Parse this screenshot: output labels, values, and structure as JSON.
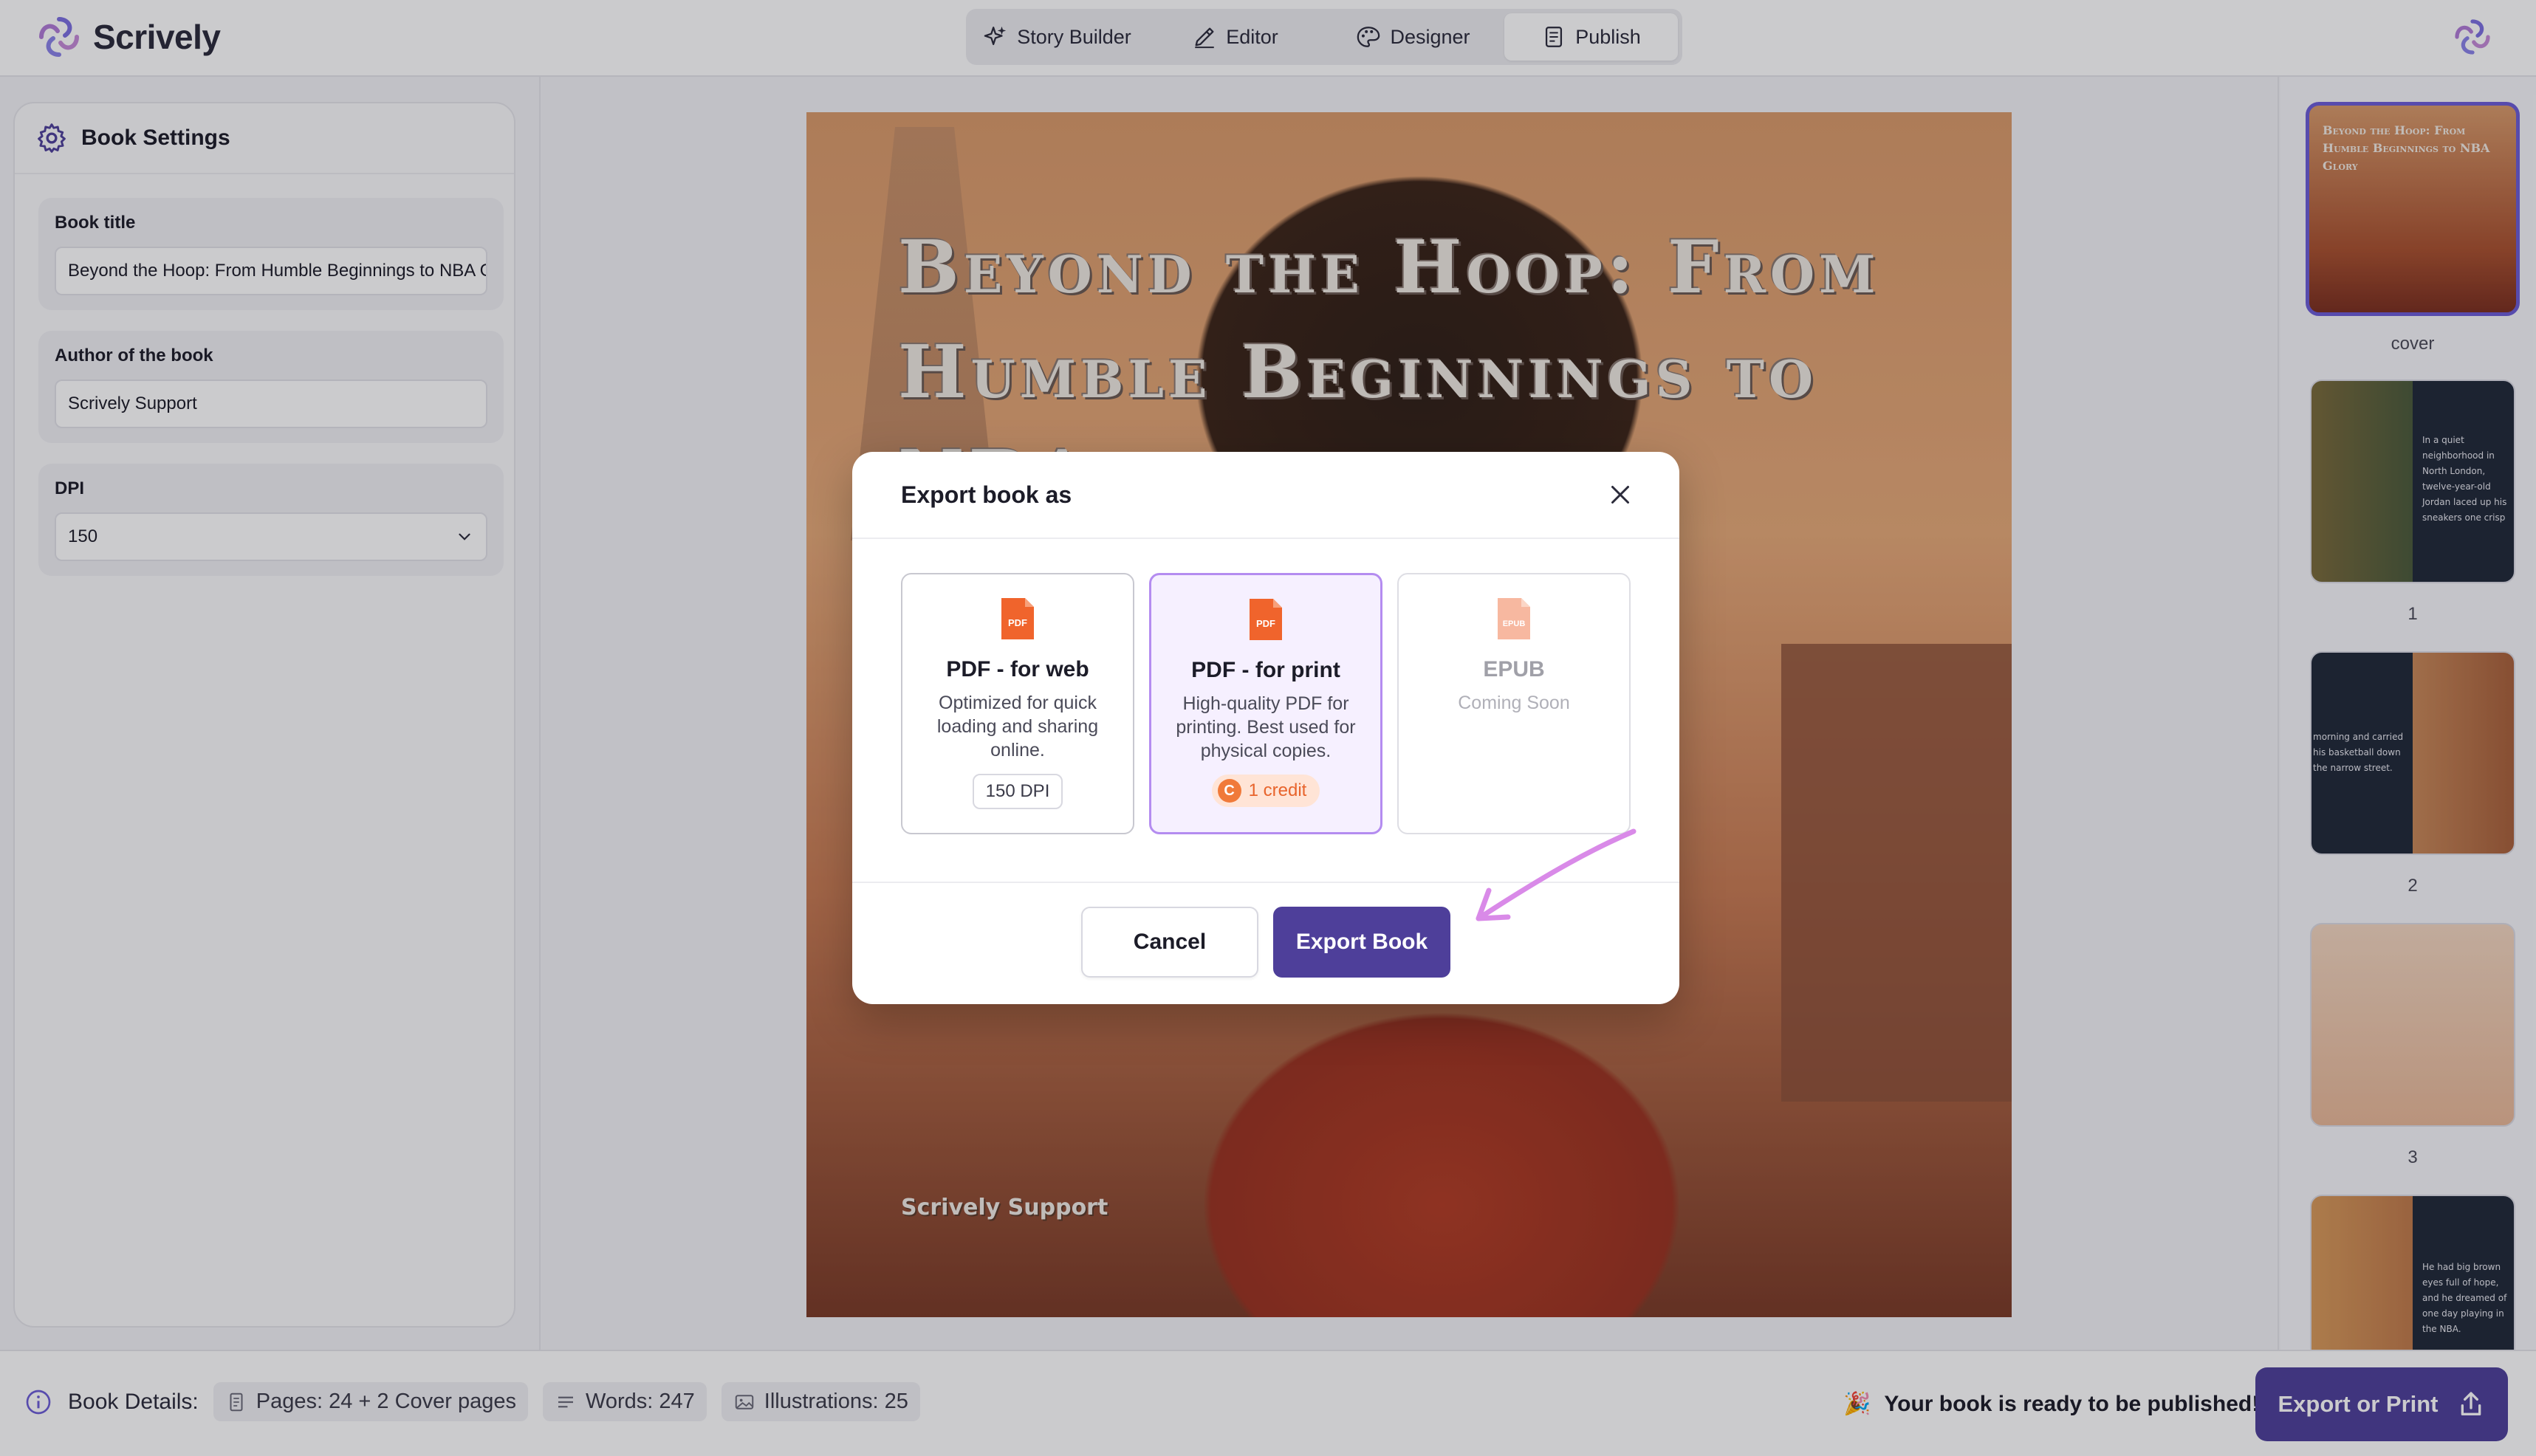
{
  "app": {
    "name": "Scrively"
  },
  "nav": {
    "tabs": [
      {
        "label": "Story Builder",
        "icon": "sparkles-icon"
      },
      {
        "label": "Editor",
        "icon": "pen-icon"
      },
      {
        "label": "Designer",
        "icon": "palette-icon"
      },
      {
        "label": "Publish",
        "icon": "book-icon",
        "active": true
      }
    ]
  },
  "settings": {
    "title": "Book Settings",
    "book_title_label": "Book title",
    "book_title_value": "Beyond the Hoop: From Humble Beginnings to NBA Glory",
    "author_label": "Author of the book",
    "author_value": "Scrively Support",
    "dpi_label": "DPI",
    "dpi_value": "150"
  },
  "cover": {
    "title": "Beyond the Hoop: From Humble Beginnings to NBA",
    "author": "Scrively Support"
  },
  "thumbnails": [
    {
      "caption": "cover",
      "title": "Beyond the Hoop: From Humble Beginnings to NBA Glory",
      "selected": true
    },
    {
      "caption": "1",
      "text": "In a quiet neighborhood in North London, twelve-year-old Jordan laced up his sneakers one crisp"
    },
    {
      "caption": "2",
      "text": "morning and carried his basketball down the narrow street."
    },
    {
      "caption": "3",
      "text": ""
    },
    {
      "caption": "",
      "text": "He had big brown eyes full of hope, and he dreamed of one day playing in the NBA."
    }
  ],
  "modal": {
    "title": "Export book as",
    "options": [
      {
        "title": "PDF - for web",
        "icon_label": "PDF",
        "desc": "Optimized for quick loading and sharing online.",
        "chip": "150 DPI"
      },
      {
        "title": "PDF - for print",
        "icon_label": "PDF",
        "desc": "High-quality PDF for printing. Best used for physical copies.",
        "chip": "1 credit",
        "coin": "C",
        "selected": true
      },
      {
        "title": "EPUB",
        "icon_label": "EPUB",
        "desc": "Coming Soon",
        "disabled": true
      }
    ],
    "cancel_label": "Cancel",
    "export_label": "Export Book"
  },
  "bottom": {
    "details_label": "Book Details:",
    "pages": "Pages: 24 + 2 Cover pages",
    "words": "Words: 247",
    "illustrations": "Illustrations: 25",
    "ready_emoji": "🎉",
    "ready_text": "Your book is ready to be published!",
    "export_print_label": "Export or Print"
  },
  "colors": {
    "accent": "#4e3f9a",
    "selected_border": "#b48cf0",
    "pdf_orange": "#f0642c",
    "annotation": "#d98ae8"
  }
}
